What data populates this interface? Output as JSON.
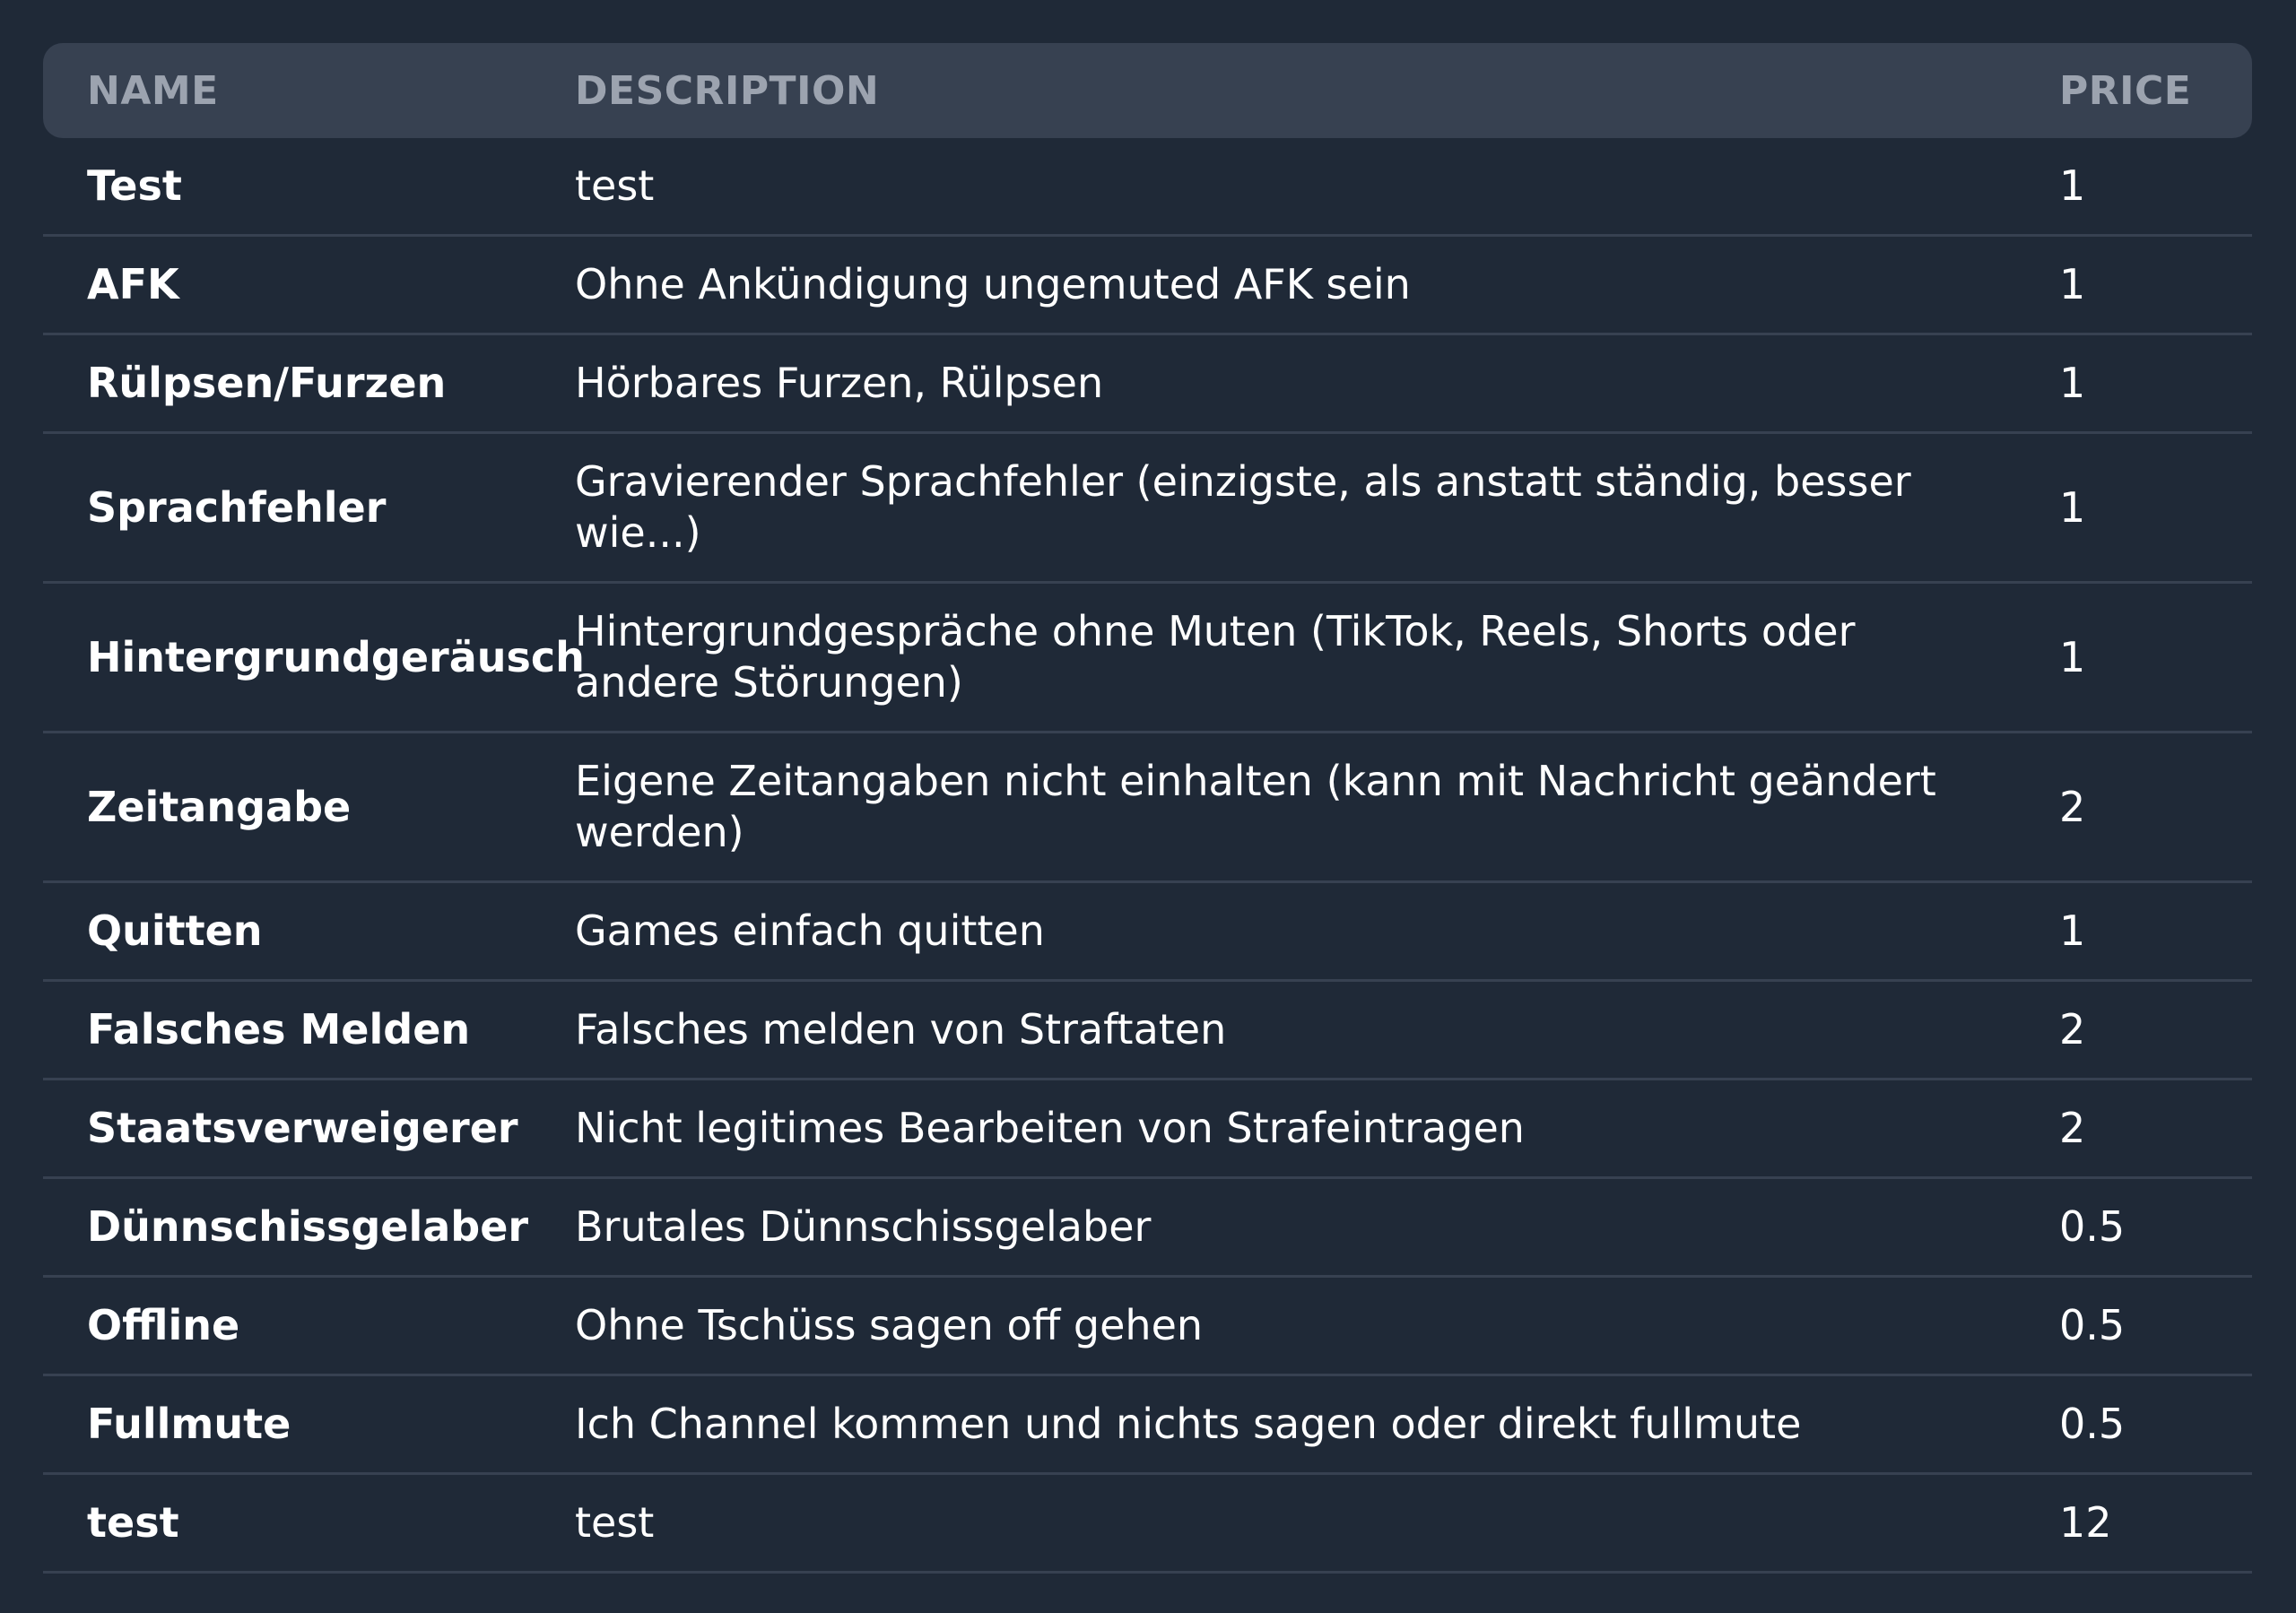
{
  "table": {
    "headers": {
      "name": "NAME",
      "description": "DESCRIPTION",
      "price": "PRICE"
    },
    "rows": [
      {
        "name": "Test",
        "description": "test",
        "price": "1"
      },
      {
        "name": "AFK",
        "description": "Ohne Ankündigung ungemuted AFK sein",
        "price": "1"
      },
      {
        "name": "Rülpsen/Furzen",
        "description": "Hörbares Furzen, Rülpsen",
        "price": "1"
      },
      {
        "name": "Sprachfehler",
        "description": "Gravierender Sprachfehler (einzigste, als anstatt ständig, besser wie...)",
        "price": "1"
      },
      {
        "name": "Hintergrundgeräusch",
        "description": "Hintergrundgespräche ohne Muten (TikTok, Reels, Shorts oder andere Störungen)",
        "price": "1"
      },
      {
        "name": "Zeitangabe",
        "description": "Eigene Zeitangaben nicht einhalten (kann mit Nachricht geändert werden)",
        "price": "2"
      },
      {
        "name": "Quitten",
        "description": "Games einfach quitten",
        "price": "1"
      },
      {
        "name": "Falsches Melden",
        "description": "Falsches melden von Straftaten",
        "price": "2"
      },
      {
        "name": "Staatsverweigerer",
        "description": "Nicht legitimes Bearbeiten von Strafeintragen",
        "price": "2"
      },
      {
        "name": "Dünnschissgelaber",
        "description": "Brutales Dünnschissgelaber",
        "price": "0.5"
      },
      {
        "name": "Offline",
        "description": "Ohne Tschüss sagen off gehen",
        "price": "0.5"
      },
      {
        "name": "Fullmute",
        "description": "Ich Channel kommen und nichts sagen oder direkt fullmute",
        "price": "0.5"
      },
      {
        "name": "test",
        "description": "test",
        "price": "12"
      }
    ]
  },
  "colors": {
    "background": "#1f2937",
    "header_background": "#374151",
    "header_text": "#9ca3af",
    "row_text": "#ffffff",
    "row_divider": "#374151"
  }
}
